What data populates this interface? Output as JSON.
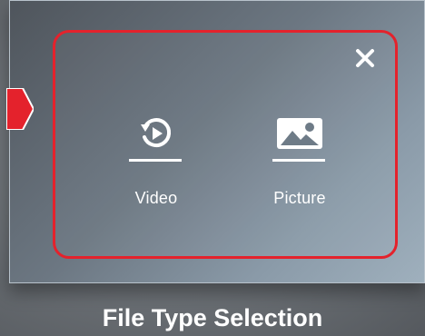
{
  "dialog": {
    "options": [
      {
        "label": "Video",
        "icon": "video-replay-icon"
      },
      {
        "label": "Picture",
        "icon": "picture-icon"
      }
    ],
    "close_icon": "close-icon"
  },
  "caption": "File Type Selection",
  "colors": {
    "accent": "#e4222c",
    "text": "#ffffff"
  }
}
